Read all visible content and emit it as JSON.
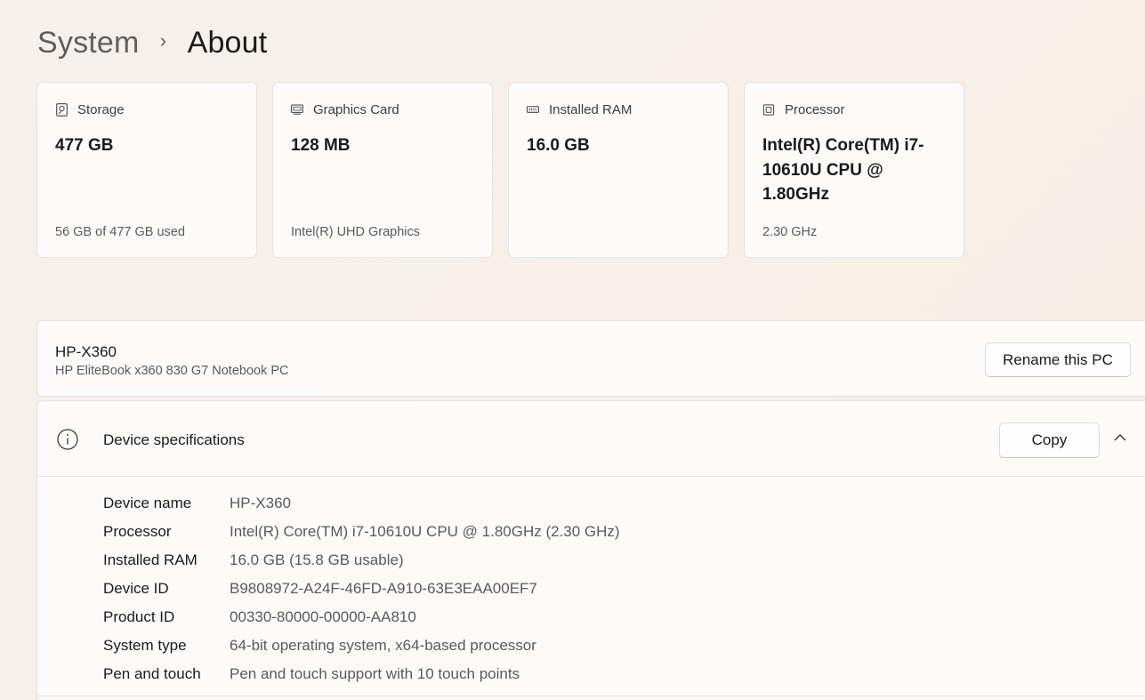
{
  "breadcrumb": {
    "parent": "System",
    "separator": "›",
    "current": "About"
  },
  "cards": [
    {
      "icon": "storage-icon",
      "label": "Storage",
      "value": "477 GB",
      "sub": "56 GB of 477 GB used"
    },
    {
      "icon": "graphics-card-icon",
      "label": "Graphics Card",
      "value": "128 MB",
      "sub": "Intel(R) UHD Graphics"
    },
    {
      "icon": "ram-icon",
      "label": "Installed RAM",
      "value": "16.0 GB",
      "sub": ""
    },
    {
      "icon": "processor-icon",
      "label": "Processor",
      "value": "Intel(R) Core(TM) i7-10610U CPU @ 1.80GHz",
      "sub": "2.30 GHz"
    }
  ],
  "pc": {
    "name": "HP-X360",
    "model": "HP EliteBook x360 830 G7 Notebook PC",
    "rename_label": "Rename this PC"
  },
  "specs": {
    "icon": "info-icon",
    "title": "Device specifications",
    "copy_label": "Copy",
    "expanded_icon": "chevron-up-icon",
    "rows": [
      {
        "label": "Device name",
        "value": "HP-X360"
      },
      {
        "label": "Processor",
        "value": "Intel(R) Core(TM) i7-10610U CPU @ 1.80GHz (2.30 GHz)"
      },
      {
        "label": "Installed RAM",
        "value": "16.0 GB (15.8 GB usable)"
      },
      {
        "label": "Device ID",
        "value": "B9808972-A24F-46FD-A910-63E3EAA00EF7"
      },
      {
        "label": "Product ID",
        "value": "00330-80000-00000-AA810"
      },
      {
        "label": "System type",
        "value": "64-bit operating system, x64-based processor"
      },
      {
        "label": "Pen and touch",
        "value": "Pen and touch support with 10 touch points"
      }
    ]
  },
  "colors": {
    "text_primary": "#1b1b1b",
    "text_secondary": "#5a5a5a",
    "card_background": "#fcfbfa",
    "border": "#e6e2df"
  }
}
